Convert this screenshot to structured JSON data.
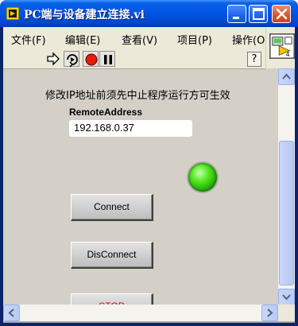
{
  "window": {
    "title": "PC端与设备建立连接.vi",
    "controls": [
      "minimize-icon",
      "maximize-icon",
      "close-icon"
    ]
  },
  "menubar": {
    "items": [
      {
        "label": "文件(F)"
      },
      {
        "label": "编辑(E)"
      },
      {
        "label": "查看(V)"
      },
      {
        "label": "项目(P)"
      },
      {
        "label": "操作(O"
      }
    ]
  },
  "toolbar": {
    "buttons": [
      "run-arrow-icon",
      "run-continuously-icon",
      "abort-icon",
      "pause-icon"
    ],
    "help_label": "?"
  },
  "vi_icon": {
    "badge": "4"
  },
  "panel": {
    "notice": "修改IP地址前须先中止程序运行方可生效",
    "address_label": "RemoteAddress",
    "address_value": "192.168.0.37",
    "connect_label": "Connect",
    "disconnect_label": "DisConnect",
    "stop_label": "STOP",
    "led_state": "on",
    "led_color": "#39d41a",
    "stop_color": "#e00000"
  }
}
